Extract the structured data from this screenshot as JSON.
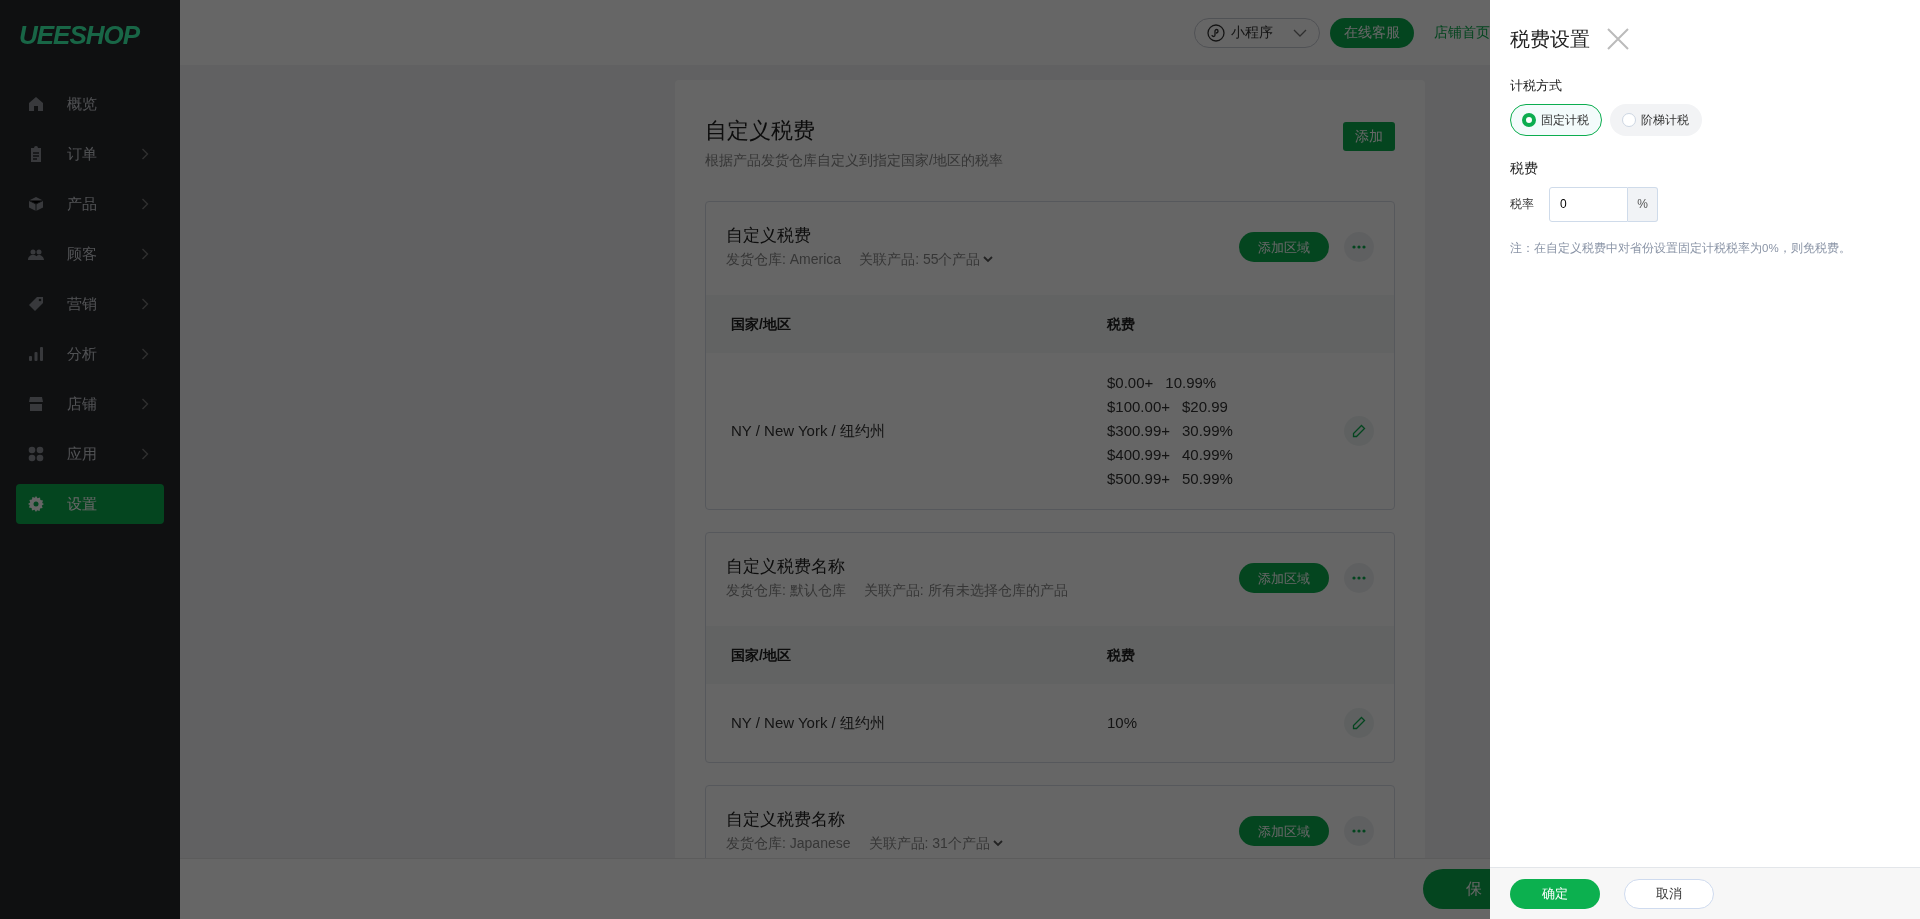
{
  "sidebar": {
    "logo": "UEESHOP",
    "items": [
      {
        "label": "概览",
        "kind": "home",
        "has_submenu": false,
        "selected": false
      },
      {
        "label": "订单",
        "kind": "clipboard",
        "has_submenu": true,
        "selected": false
      },
      {
        "label": "产品",
        "kind": "cube",
        "has_submenu": true,
        "selected": false
      },
      {
        "label": "顾客",
        "kind": "users",
        "has_submenu": true,
        "selected": false
      },
      {
        "label": "营销",
        "kind": "tag",
        "has_submenu": true,
        "selected": false
      },
      {
        "label": "分析",
        "kind": "chart",
        "has_submenu": true,
        "selected": false
      },
      {
        "label": "店铺",
        "kind": "store",
        "has_submenu": true,
        "selected": false
      },
      {
        "label": "应用",
        "kind": "apps",
        "has_submenu": true,
        "selected": false
      },
      {
        "label": "设置",
        "kind": "gear",
        "has_submenu": false,
        "selected": true
      }
    ]
  },
  "topbar": {
    "mini_program": "小程序",
    "support_button": "在线客服",
    "store_link": "店铺首页"
  },
  "page": {
    "title": "自定义税费",
    "subtitle": "根据产品发货仓库自定义到指定国家/地区的税率",
    "add_button": "添加",
    "tax_groups": [
      {
        "name": "自定义税费",
        "warehouse": "发货仓库: America",
        "products": "关联产品: 55个产品",
        "products_expandable": true,
        "add_region_button": "添加区域",
        "columns": [
          "国家/地区",
          "税费"
        ],
        "rows": [
          {
            "region": "NY / New York / 纽约州",
            "kind": "tiered",
            "tiers": [
              {
                "threshold": "$0.00+",
                "rate": "10.99%"
              },
              {
                "threshold": "$100.00+",
                "rate": "$20.99"
              },
              {
                "threshold": "$300.99+",
                "rate": "30.99%"
              },
              {
                "threshold": "$400.99+",
                "rate": "40.99%"
              },
              {
                "threshold": "$500.99+",
                "rate": "50.99%"
              }
            ]
          }
        ]
      },
      {
        "name": "自定义税费名称",
        "warehouse": "发货仓库: 默认仓库",
        "products": "关联产品: 所有未选择仓库的产品",
        "products_expandable": false,
        "add_region_button": "添加区域",
        "columns": [
          "国家/地区",
          "税费"
        ],
        "rows": [
          {
            "region": "NY / New York / 纽约州",
            "kind": "flat",
            "rate": "10%"
          }
        ]
      },
      {
        "name": "自定义税费名称",
        "warehouse": "发货仓库: Japanese",
        "products": "关联产品: 31个产品",
        "products_expandable": true,
        "add_region_button": "添加区域"
      }
    ]
  },
  "bottom_bar": {
    "save_button": "保"
  },
  "drawer": {
    "title": "税费设置",
    "method_label": "计税方式",
    "methods": [
      {
        "label": "固定计税",
        "selected": true
      },
      {
        "label": "阶梯计税",
        "selected": false
      }
    ],
    "tax_label": "税费",
    "rate_label": "税率",
    "rate_value": "0",
    "rate_suffix": "%",
    "note": "注：在自定义税费中对省份设置固定计税税率为0%，则免税费。",
    "confirm_button": "确定",
    "cancel_button": "取消"
  }
}
